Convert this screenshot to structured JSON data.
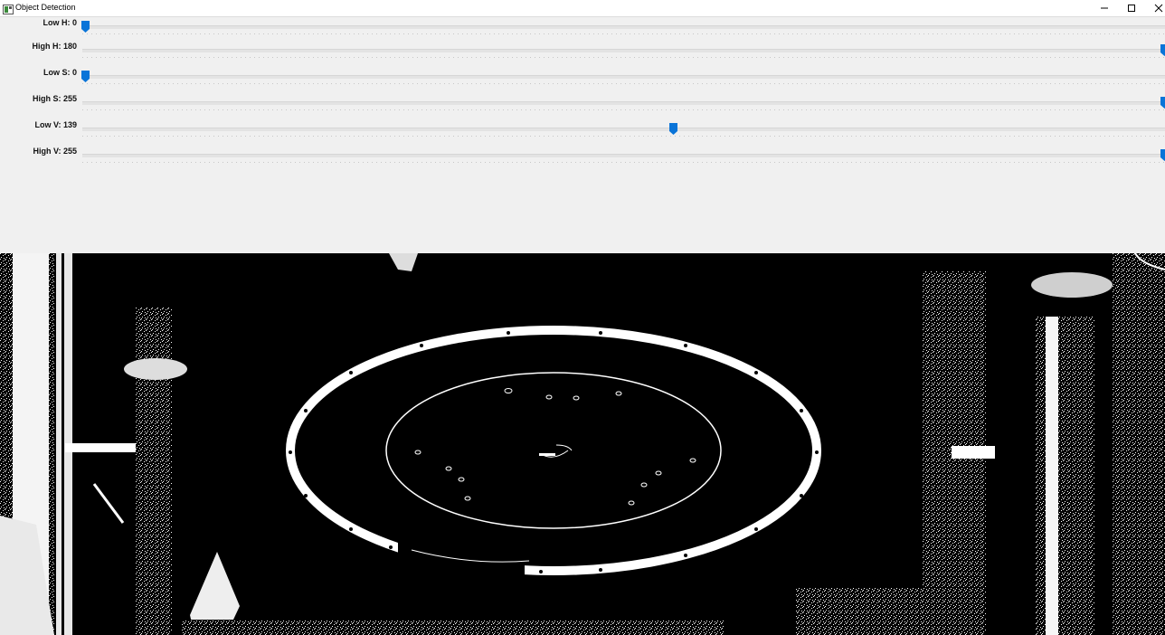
{
  "window": {
    "title": "Object Detection",
    "icons": {
      "app": "app-window-icon",
      "minimize": "minimize-icon",
      "maximize": "maximize-icon",
      "close": "close-icon"
    }
  },
  "trackbars": [
    {
      "label": "Low H: 0",
      "value": 0,
      "max": 180
    },
    {
      "label": "High H: 180",
      "value": 180,
      "max": 180
    },
    {
      "label": "Low S: 0",
      "value": 0,
      "max": 255
    },
    {
      "label": "High S: 255",
      "value": 255,
      "max": 255
    },
    {
      "label": "Low V: 139",
      "value": 139,
      "max": 255
    },
    {
      "label": "High V: 255",
      "value": 255,
      "max": 255
    }
  ],
  "colors": {
    "thumb": "#0a74d8",
    "track": "#e3e3e3",
    "mask_fg": "#ffffff",
    "mask_bg": "#000000"
  }
}
